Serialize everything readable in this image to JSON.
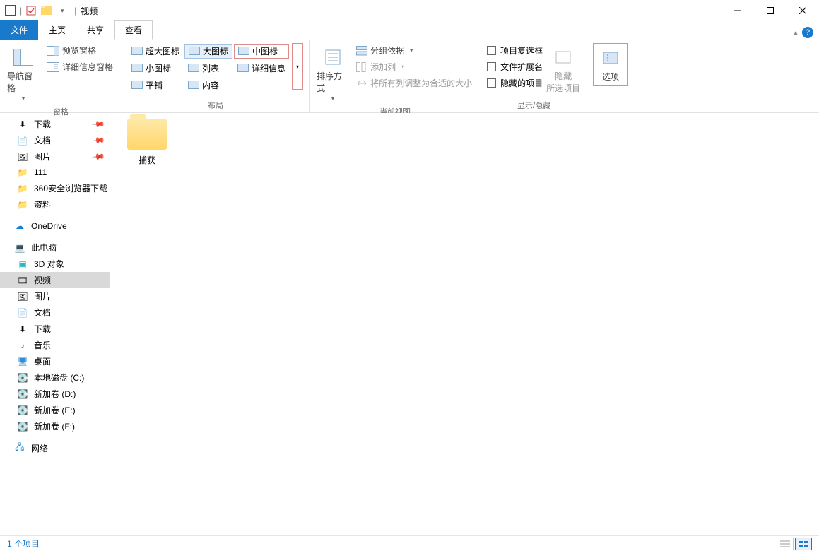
{
  "window": {
    "title": "视频"
  },
  "tabs": {
    "file": "文件",
    "home": "主页",
    "share": "共享",
    "view": "查看"
  },
  "ribbon": {
    "panes": {
      "label": "窗格",
      "nav": "导航窗格",
      "preview": "预览窗格",
      "details": "详细信息窗格"
    },
    "layout": {
      "label": "布局",
      "xlarge": "超大图标",
      "large": "大图标",
      "medium": "中图标",
      "small": "小图标",
      "list": "列表",
      "detailslist": "详细信息",
      "tiles": "平铺",
      "content": "内容"
    },
    "currentview": {
      "label": "当前视图",
      "sort": "排序方式",
      "group": "分组依据",
      "addcol": "添加列",
      "autosize": "将所有列调整为合适的大小"
    },
    "showhide": {
      "label": "显示/隐藏",
      "chk1": "项目复选框",
      "chk2": "文件扩展名",
      "chk3": "隐藏的项目",
      "hidebtn": "隐藏\n所选项目"
    },
    "options": "选项"
  },
  "nav": {
    "downloads": "下载",
    "documents": "文档",
    "pictures": "图片",
    "f111": "111",
    "f360": "360安全浏览器下载",
    "fdata": "资料",
    "onedrive": "OneDrive",
    "thispc": "此电脑",
    "obj3d": "3D 对象",
    "videos": "视频",
    "pictures2": "图片",
    "documents2": "文档",
    "downloads2": "下载",
    "music": "音乐",
    "desktop": "桌面",
    "diskc": "本地磁盘 (C:)",
    "diskd": "新加卷 (D:)",
    "diske": "新加卷 (E:)",
    "diskf": "新加卷 (F:)",
    "network": "网络"
  },
  "content": {
    "folder1": "捕获"
  },
  "status": {
    "count": "1 个项目"
  }
}
